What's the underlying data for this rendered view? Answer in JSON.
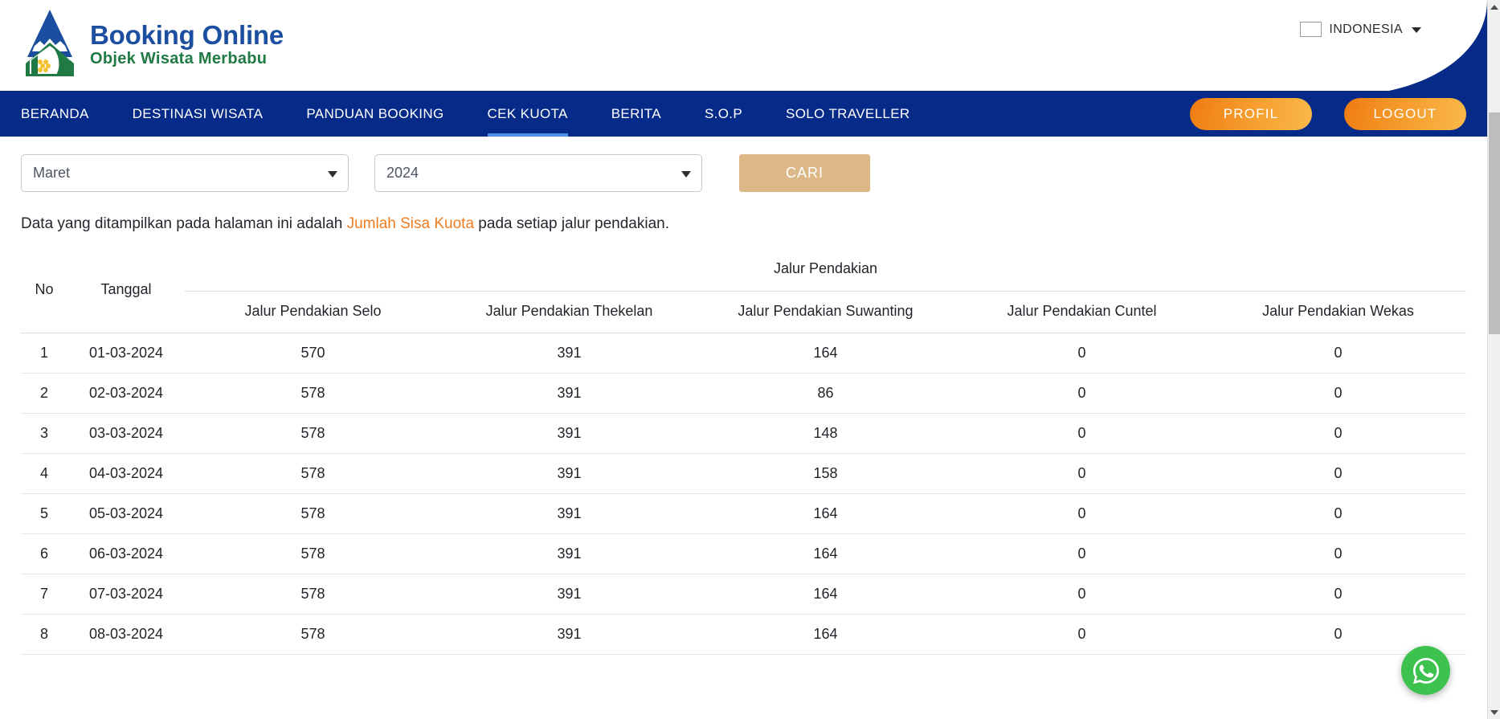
{
  "header": {
    "logo_icon": "mountain-house-logo",
    "brand_title": "Booking Online",
    "brand_subtitle": "Objek Wisata Merbabu",
    "language": {
      "flag_icon": "indonesia-flag-icon",
      "label": "INDONESIA",
      "caret_icon": "chevron-down-icon"
    }
  },
  "nav": {
    "items": [
      {
        "label": "BERANDA",
        "active": false
      },
      {
        "label": "DESTINASI WISATA",
        "active": false
      },
      {
        "label": "PANDUAN BOOKING",
        "active": false
      },
      {
        "label": "CEK KUOTA",
        "active": true
      },
      {
        "label": "BERITA",
        "active": false
      },
      {
        "label": "S.O.P",
        "active": false
      },
      {
        "label": "SOLO TRAVELLER",
        "active": false
      }
    ],
    "profile_label": "PROFIL",
    "logout_label": "LOGOUT",
    "bar_color": "#062a87",
    "active_underline_color": "#4f8fe8",
    "button_gradient_from": "#ef7c12",
    "button_gradient_to": "#f9b94a"
  },
  "filters": {
    "month": {
      "value": "Maret",
      "arrow_icon": "chevron-down-icon"
    },
    "year": {
      "value": "2024",
      "arrow_icon": "chevron-down-icon"
    },
    "search_label": "CARI",
    "search_color": "#ddb887"
  },
  "note": {
    "prefix": "Data yang ditampilkan pada halaman ini adalah ",
    "highlight": "Jumlah Sisa Kuota",
    "suffix": " pada setiap jalur pendakian.",
    "highlight_color": "#f07c1f"
  },
  "table": {
    "col_no": "No",
    "col_tanggal": "Tanggal",
    "group_header": "Jalur Pendakian",
    "subheaders": [
      "Jalur Pendakian Selo",
      "Jalur Pendakian Thekelan",
      "Jalur Pendakian Suwanting",
      "Jalur Pendakian Cuntel",
      "Jalur Pendakian Wekas"
    ],
    "rows": [
      {
        "no": "1",
        "tanggal": "01-03-2024",
        "selo": "570",
        "thekelan": "391",
        "suwanting": "164",
        "cuntel": "0",
        "wekas": "0"
      },
      {
        "no": "2",
        "tanggal": "02-03-2024",
        "selo": "578",
        "thekelan": "391",
        "suwanting": "86",
        "cuntel": "0",
        "wekas": "0"
      },
      {
        "no": "3",
        "tanggal": "03-03-2024",
        "selo": "578",
        "thekelan": "391",
        "suwanting": "148",
        "cuntel": "0",
        "wekas": "0"
      },
      {
        "no": "4",
        "tanggal": "04-03-2024",
        "selo": "578",
        "thekelan": "391",
        "suwanting": "158",
        "cuntel": "0",
        "wekas": "0"
      },
      {
        "no": "5",
        "tanggal": "05-03-2024",
        "selo": "578",
        "thekelan": "391",
        "suwanting": "164",
        "cuntel": "0",
        "wekas": "0"
      },
      {
        "no": "6",
        "tanggal": "06-03-2024",
        "selo": "578",
        "thekelan": "391",
        "suwanting": "164",
        "cuntel": "0",
        "wekas": "0"
      },
      {
        "no": "7",
        "tanggal": "07-03-2024",
        "selo": "578",
        "thekelan": "391",
        "suwanting": "164",
        "cuntel": "0",
        "wekas": "0"
      },
      {
        "no": "8",
        "tanggal": "08-03-2024",
        "selo": "578",
        "thekelan": "391",
        "suwanting": "164",
        "cuntel": "0",
        "wekas": "0"
      }
    ]
  },
  "floating": {
    "whatsapp_icon": "whatsapp-icon",
    "whatsapp_color": "#3dc14f"
  },
  "scrollbar": {
    "up_icon": "scroll-up-arrow-icon",
    "down_icon": "scroll-down-arrow-icon"
  }
}
